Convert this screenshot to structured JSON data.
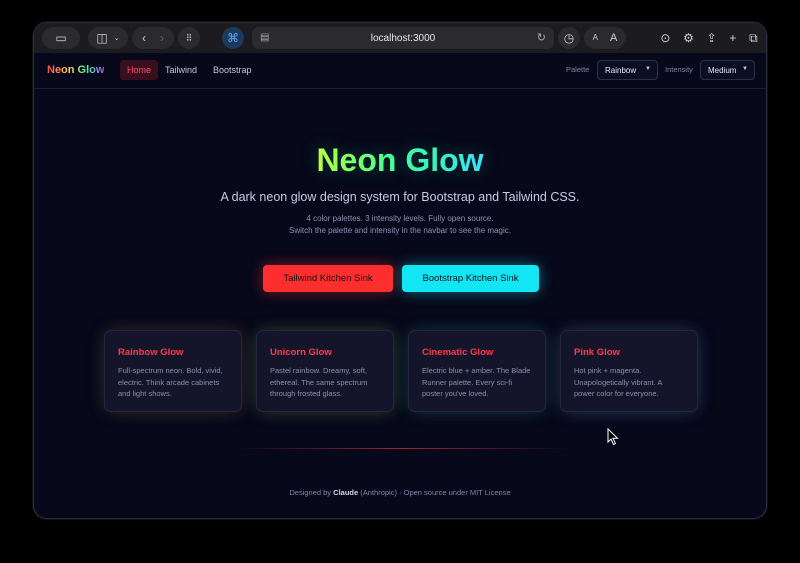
{
  "browser": {
    "url": "localhost:3000",
    "text_size_small": "A",
    "text_size_large": "A"
  },
  "navbar": {
    "brand": "Neon Glow",
    "links": [
      "Home",
      "Tailwind",
      "Bootstrap"
    ],
    "palette_label": "Palette",
    "palette_value": "Rainbow",
    "intensity_label": "Intensity",
    "intensity_value": "Medium"
  },
  "hero": {
    "title": "Neon Glow",
    "subtitle": "A dark neon glow design system for Bootstrap and Tailwind CSS.",
    "note_line1": "4 color palettes. 3 intensity levels. Fully open source.",
    "note_line2": "Switch the palette and intensity in the navbar to see the magic.",
    "btn_tailwind": "Tailwind Kitchen Sink",
    "btn_bootstrap": "Bootstrap Kitchen Sink"
  },
  "cards": [
    {
      "title": "Rainbow Glow",
      "desc": "Full-spectrum neon. Bold, vivid, electric. Think arcade cabinets and light shows."
    },
    {
      "title": "Unicorn Glow",
      "desc": "Pastel rainbow. Dreamy, soft, ethereal. The same spectrum through frosted glass."
    },
    {
      "title": "Cinematic Glow",
      "desc": "Electric blue + amber. The Blade Runner palette. Every sci-fi poster you've loved."
    },
    {
      "title": "Pink Glow",
      "desc": "Hot pink + magenta. Unapologetically vibrant. A power color for everyone."
    }
  ],
  "footer": {
    "prefix": "Designed by",
    "author": "Claude",
    "suffix": "(Anthropic) · Open source under MIT License"
  },
  "colors": {
    "accent_red": "#ff2e2e",
    "accent_cyan": "#12e6f5",
    "background": "#07081a"
  }
}
